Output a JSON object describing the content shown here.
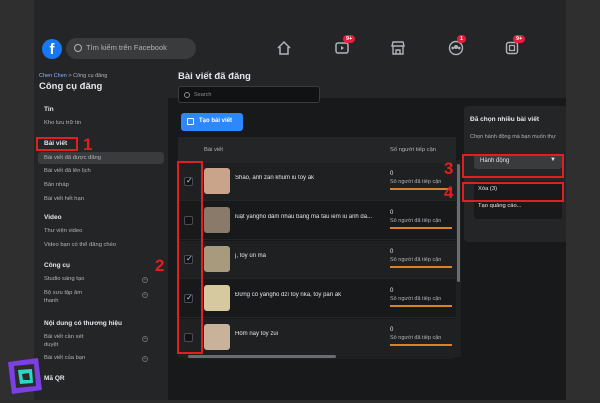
{
  "topbar": {
    "logo": "f",
    "search_placeholder": "Tìm kiếm trên Facebook",
    "nav_badges": [
      "9+",
      "1",
      "9+"
    ]
  },
  "sidebar": {
    "breadcrumb_link": "Chen Chen",
    "breadcrumb_rest": " > Công cụ đăng",
    "title": "Công cụ đăng",
    "sections": {
      "tin": "Tin",
      "kho_luu_tru_tin": "Kho lưu trữ tin",
      "bai_viet": "Bài viết",
      "bai_viet_da_duoc_dang": "Bài viết đã được đăng",
      "bai_viet_da_len_lich": "Bài viết đã lên lịch",
      "ban_nhap": "Bản nháp",
      "bai_viet_het_han": "Bài viết hết hạn",
      "video": "Video",
      "thu_vien_video": "Thư viện video",
      "video_ban_co_the_dang_cheo": "Video bạn có thể đăng chéo",
      "cong_cu": "Công cụ",
      "studio_sang_tao": "Studio sáng tạo",
      "bo_suu_tap_am": "Bộ sưu tập âm",
      "thanh": "thanh",
      "noi_dung_thuong_hieu": "Nội dung có thương hiệu",
      "bai_viet_can_xet": "Bài viết cần xét",
      "duyet": "duyệt",
      "bai_viet_cua_ban": "Bài viết của bạn",
      "ma_qr": "Mã QR"
    }
  },
  "main": {
    "title": "Bài viết đã đăng",
    "search_placeholder": "Search",
    "create_button": "Tạo bài viết",
    "col_post": "Bài viết",
    "col_reach": "Số người tiếp cận",
    "rows": [
      {
        "text": "Shao, anh zẫn khum iu toy ák",
        "count": "0",
        "sub": "Số người đã tiếp cận",
        "checked": true,
        "thumb_color": "#c9a48a"
      },
      {
        "text": "luật yangho đảm nhau bằng mã tấu iem iu anh đã...",
        "count": "0",
        "sub": "Số người đã tiếp cận",
        "checked": false,
        "thumb_color": "#8a7a6a"
      },
      {
        "text": "j, toy ún mà",
        "count": "0",
        "sub": "Số người đã tiếp cận",
        "checked": true,
        "thumb_color": "#a89a7c"
      },
      {
        "text": "Đừng có yangho dzí toy nka, toy pắn ák",
        "count": "0",
        "sub": "Số người đã tiếp cận",
        "checked": true,
        "thumb_color": "#d6c9a0"
      },
      {
        "text": "Hôm nay toy zui",
        "count": "0",
        "sub": "Số người đã tiếp cận",
        "checked": false,
        "thumb_color": "#c9b29a"
      }
    ]
  },
  "panel": {
    "title": "Đã chọn nhiều bài viết",
    "desc": "Chọn hành động mà bạn muốn thự",
    "select_value": "Hành động",
    "options": [
      "Xóa (3)",
      "Tạo quảng cáo..."
    ]
  },
  "annotations": [
    "1",
    "2",
    "3",
    "4"
  ],
  "colors": {
    "accent": "#2d88ff",
    "annotation": "#e02020",
    "reach_bar": "#d9822b"
  }
}
